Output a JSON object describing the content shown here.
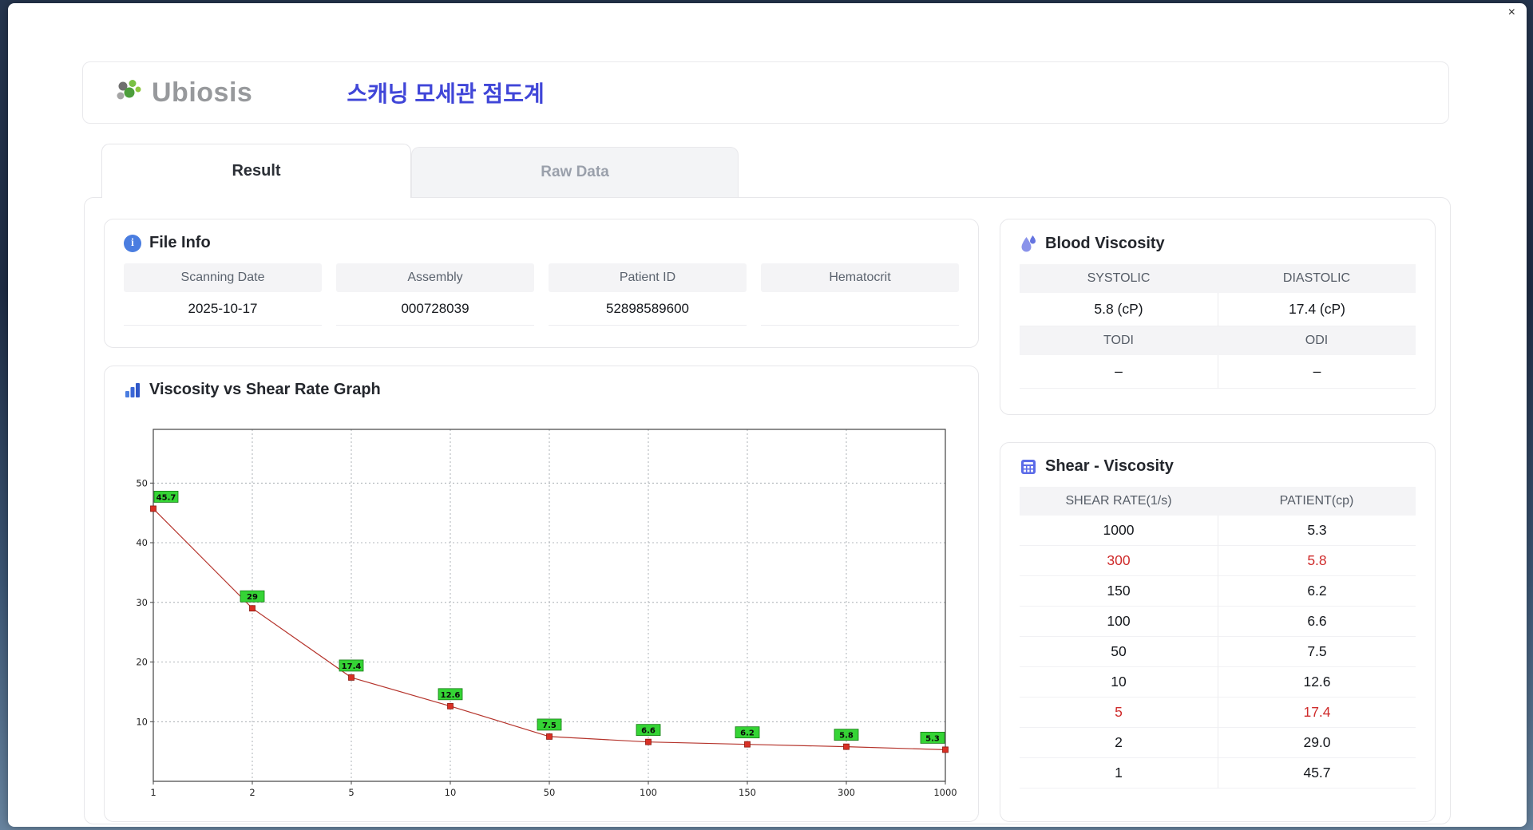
{
  "window": {
    "close_label": "×"
  },
  "header": {
    "logo_text": "Ubiosis",
    "app_title": "스캐닝 모세관 점도계"
  },
  "tabs": {
    "result": "Result",
    "raw": "Raw Data"
  },
  "file_info": {
    "title": "File Info",
    "fields": [
      {
        "label": "Scanning Date",
        "value": "2025-10-17"
      },
      {
        "label": "Assembly",
        "value": "000728039"
      },
      {
        "label": "Patient ID",
        "value": "52898589600"
      },
      {
        "label": "Hematocrit",
        "value": ""
      }
    ]
  },
  "blood_viscosity": {
    "title": "Blood Viscosity",
    "rows": [
      {
        "labels": [
          "SYSTOLIC",
          "DIASTOLIC"
        ],
        "values": [
          "5.8 (cP)",
          "17.4 (cP)"
        ]
      },
      {
        "labels": [
          "TODI",
          "ODI"
        ],
        "values": [
          "–",
          "–"
        ]
      }
    ]
  },
  "graph": {
    "title": "Viscosity vs Shear Rate Graph"
  },
  "chart_data": {
    "type": "line",
    "title": "Viscosity vs Shear Rate Graph",
    "x_scale": "category",
    "x_categories": [
      "1",
      "2",
      "5",
      "10",
      "50",
      "100",
      "150",
      "300",
      "1000"
    ],
    "values": [
      45.7,
      29,
      17.4,
      12.6,
      7.5,
      6.6,
      6.2,
      5.8,
      5.3
    ],
    "point_labels": [
      "45.7",
      "29",
      "17.4",
      "12.6",
      "7.5",
      "6.6",
      "6.2",
      "5.8",
      "5.3"
    ],
    "yticks": [
      10,
      20,
      30,
      40,
      50
    ],
    "ylim": [
      0,
      59
    ],
    "grid": true,
    "line_color": "#b5342c",
    "marker_color": "#d93025",
    "marker_border_color": "#8b1a10",
    "label_bg_color": "#35d435",
    "label_border_color": "#157a15"
  },
  "shear_table": {
    "title": "Shear - Viscosity",
    "headers": [
      "SHEAR RATE(1/s)",
      "PATIENT(cp)"
    ],
    "highlight_color": "#cf2b2b",
    "rows": [
      {
        "rate": "1000",
        "patient": "5.3",
        "highlight": false
      },
      {
        "rate": "300",
        "patient": "5.8",
        "highlight": true
      },
      {
        "rate": "150",
        "patient": "6.2",
        "highlight": false
      },
      {
        "rate": "100",
        "patient": "6.6",
        "highlight": false
      },
      {
        "rate": "50",
        "patient": "7.5",
        "highlight": false
      },
      {
        "rate": "10",
        "patient": "12.6",
        "highlight": false
      },
      {
        "rate": "5",
        "patient": "17.4",
        "highlight": true
      },
      {
        "rate": "2",
        "patient": "29.0",
        "highlight": false
      },
      {
        "rate": "1",
        "patient": "45.7",
        "highlight": false
      }
    ]
  }
}
